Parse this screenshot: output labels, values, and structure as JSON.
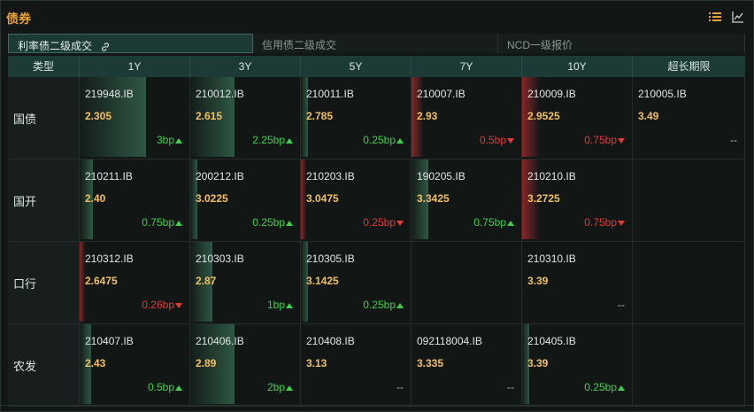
{
  "header": {
    "title": "债券"
  },
  "icons": {
    "list": "list-icon",
    "chart": "line-chart-icon"
  },
  "colors": {
    "accent": "#e9a23a",
    "up": "#3fce4e",
    "down": "#e03a3a",
    "yield": "#f0c061"
  },
  "tabs": [
    {
      "label": "利率债二级成交",
      "active": true
    },
    {
      "label": "信用债二级成交",
      "active": false
    },
    {
      "label": "NCD一级报价",
      "active": false
    }
  ],
  "columns": [
    "类型",
    "1Y",
    "3Y",
    "5Y",
    "7Y",
    "10Y",
    "超长期限"
  ],
  "rows": [
    {
      "type": "国债",
      "cells": [
        {
          "code": "219948.IB",
          "yield": "2.305",
          "change": "3bp",
          "dir": "up",
          "level": 0.6
        },
        {
          "code": "210012.IB",
          "yield": "2.615",
          "change": "2.25bp",
          "dir": "up",
          "level": 0.4
        },
        {
          "code": "210011.IB",
          "yield": "2.785",
          "change": "0.25bp",
          "dir": "up",
          "level": 0.05
        },
        {
          "code": "210007.IB",
          "yield": "2.93",
          "change": "0.5bp",
          "dir": "down",
          "level": 0.1
        },
        {
          "code": "210009.IB",
          "yield": "2.9525",
          "change": "0.75bp",
          "dir": "down",
          "level": 0.15
        },
        {
          "code": "210005.IB",
          "yield": "3.49",
          "change": "--",
          "dir": "flat",
          "level": 0
        }
      ]
    },
    {
      "type": "国开",
      "cells": [
        {
          "code": "210211.IB",
          "yield": "2.40",
          "change": "0.75bp",
          "dir": "up",
          "level": 0.12
        },
        {
          "code": "200212.IB",
          "yield": "3.0225",
          "change": "0.25bp",
          "dir": "up",
          "level": 0.05
        },
        {
          "code": "210203.IB",
          "yield": "3.0475",
          "change": "0.25bp",
          "dir": "down",
          "level": 0.05
        },
        {
          "code": "190205.IB",
          "yield": "3.3425",
          "change": "0.75bp",
          "dir": "up",
          "level": 0.15
        },
        {
          "code": "210210.IB",
          "yield": "3.2725",
          "change": "0.75bp",
          "dir": "down",
          "level": 0.15
        },
        {
          "code": "",
          "yield": "",
          "change": "",
          "dir": "none",
          "level": 0
        }
      ]
    },
    {
      "type": "口行",
      "cells": [
        {
          "code": "210312.IB",
          "yield": "2.6475",
          "change": "0.26bp",
          "dir": "down",
          "level": 0.05
        },
        {
          "code": "210303.IB",
          "yield": "2.87",
          "change": "1bp",
          "dir": "up",
          "level": 0.2
        },
        {
          "code": "210305.IB",
          "yield": "3.1425",
          "change": "0.25bp",
          "dir": "up",
          "level": 0.05
        },
        {
          "code": "",
          "yield": "",
          "change": "",
          "dir": "none",
          "level": 0
        },
        {
          "code": "210310.IB",
          "yield": "3.39",
          "change": "--",
          "dir": "flat",
          "level": 0
        },
        {
          "code": "",
          "yield": "",
          "change": "",
          "dir": "none",
          "level": 0
        }
      ]
    },
    {
      "type": "农发",
      "cells": [
        {
          "code": "210407.IB",
          "yield": "2.43",
          "change": "0.5bp",
          "dir": "up",
          "level": 0.1
        },
        {
          "code": "210406.IB",
          "yield": "2.89",
          "change": "2bp",
          "dir": "up",
          "level": 0.4
        },
        {
          "code": "210408.IB",
          "yield": "3.13",
          "change": "--",
          "dir": "flat",
          "level": 0
        },
        {
          "code": "092118004.IB",
          "yield": "3.335",
          "change": "--",
          "dir": "flat",
          "level": 0
        },
        {
          "code": "210405.IB",
          "yield": "3.39",
          "change": "0.25bp",
          "dir": "up",
          "level": 0.05
        },
        {
          "code": "",
          "yield": "",
          "change": "",
          "dir": "none",
          "level": 0
        }
      ]
    }
  ]
}
